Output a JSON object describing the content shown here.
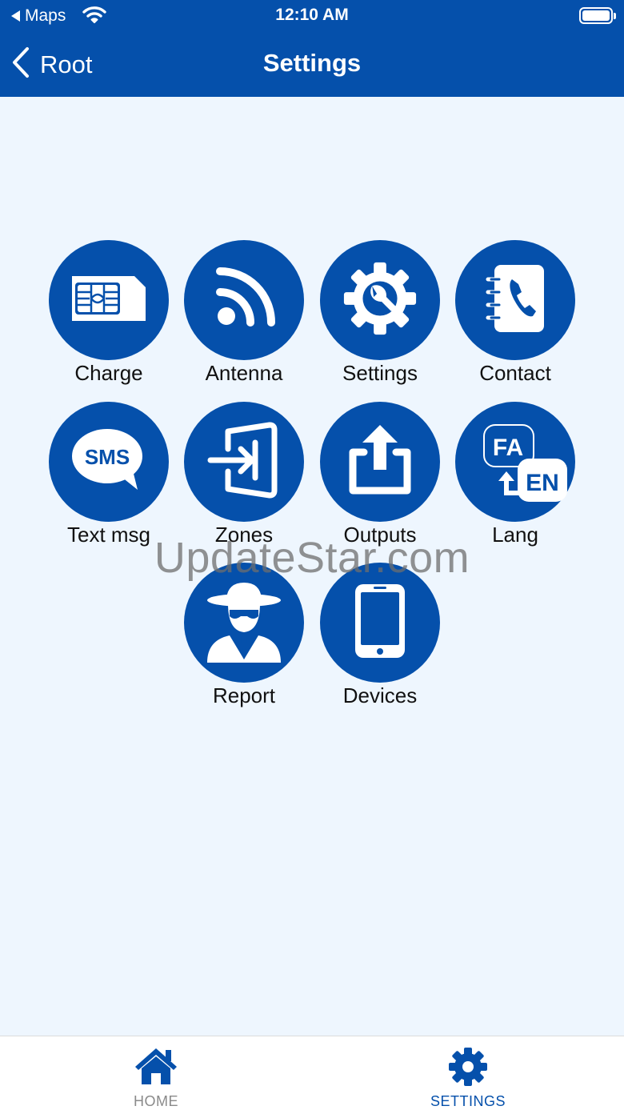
{
  "status_bar": {
    "back_app": "Maps",
    "time": "12:10 AM"
  },
  "nav": {
    "back_label": "Root",
    "title": "Settings"
  },
  "colors": {
    "primary": "#0550ab",
    "background": "#eef6fe",
    "tab_inactive": "#8a8a8a"
  },
  "tiles": [
    {
      "label": "Charge",
      "icon": "sim-card-icon"
    },
    {
      "label": "Antenna",
      "icon": "rss-antenna-icon"
    },
    {
      "label": "Settings",
      "icon": "gear-wrench-icon"
    },
    {
      "label": "Contact",
      "icon": "contact-book-icon"
    },
    {
      "label": "Text msg",
      "icon": "sms-bubble-icon",
      "icon_text": "SMS"
    },
    {
      "label": "Zones",
      "icon": "zone-enter-icon"
    },
    {
      "label": "Outputs",
      "icon": "upload-tray-icon"
    },
    {
      "label": "Lang",
      "icon": "language-switch-icon",
      "icon_text_a": "FA",
      "icon_text_b": "EN"
    },
    {
      "label": "Report",
      "icon": "spy-agent-icon"
    },
    {
      "label": "Devices",
      "icon": "tablet-icon"
    }
  ],
  "watermark": "UpdateStar.com",
  "tabbar": {
    "home_label": "HOME",
    "settings_label": "SETTINGS",
    "active": "settings"
  }
}
